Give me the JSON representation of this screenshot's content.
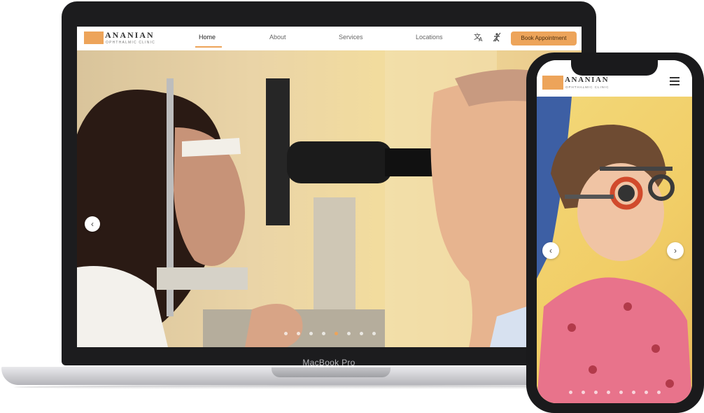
{
  "brand": {
    "name": "ANANIAN",
    "tagline": "OPHTHALMIC CLINIC",
    "accent": "#eda45a"
  },
  "nav": {
    "links": [
      {
        "label": "Home",
        "active": true
      },
      {
        "label": "About",
        "active": false
      },
      {
        "label": "Services",
        "active": false
      },
      {
        "label": "Locations",
        "active": false
      }
    ],
    "icons": [
      "translate-icon",
      "accessibility-icon"
    ],
    "cta": "Book Appointment"
  },
  "hero": {
    "prev_glyph": "‹",
    "next_glyph": "›",
    "slide_count": 8,
    "active_slide": 5
  },
  "device": {
    "laptop_label": "MacBook Pro"
  },
  "phone": {
    "menu_icon": "hamburger-menu-icon",
    "prev_glyph": "‹",
    "next_glyph": "›",
    "slide_count": 8
  }
}
